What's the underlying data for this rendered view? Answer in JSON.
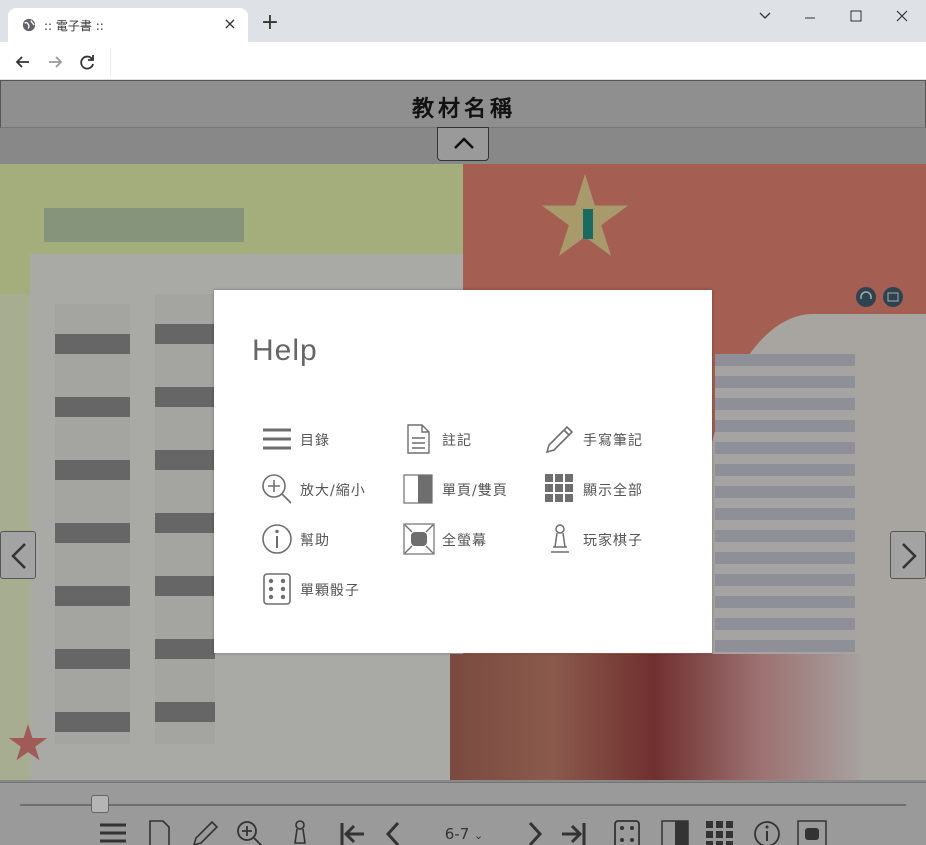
{
  "browser": {
    "tab_title": ":: 電子書 ::",
    "new_tab_label": "+",
    "tab_close_label": "×"
  },
  "book": {
    "title": "教材名稱"
  },
  "toolbar": {
    "page_value": "6-7",
    "slider_position": 0.09
  },
  "help": {
    "title": "Help",
    "items": [
      {
        "label": "目錄",
        "icon": "menu-icon"
      },
      {
        "label": "註記",
        "icon": "note-icon"
      },
      {
        "label": "手寫筆記",
        "icon": "pencil-icon"
      },
      {
        "label": "放大/縮小",
        "icon": "zoom-icon"
      },
      {
        "label": "單頁/雙頁",
        "icon": "single-double-page-icon"
      },
      {
        "label": "顯示全部",
        "icon": "grid-icon"
      },
      {
        "label": "幫助",
        "icon": "info-icon"
      },
      {
        "label": "全螢幕",
        "icon": "fullscreen-icon"
      },
      {
        "label": "玩家棋子",
        "icon": "pawn-icon"
      },
      {
        "label": "單顆骰子",
        "icon": "dice-icon"
      }
    ]
  },
  "colors": {
    "modal_text": "#555555",
    "icon_gray": "#6e6e6e",
    "page_left": "#c8d4a0",
    "page_right": "#e8806c"
  }
}
